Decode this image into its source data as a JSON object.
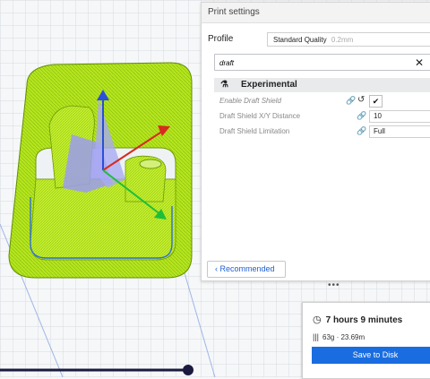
{
  "panel": {
    "title": "Print settings",
    "profile_label": "Profile",
    "profile_value": "Standard Quality",
    "profile_layer": "0.2mm",
    "search_value": "draft",
    "category": "Experimental",
    "settings": [
      {
        "label": "Enable Draft Shield",
        "type": "checkbox",
        "checked": true
      },
      {
        "label": "Draft Shield X/Y Distance",
        "type": "number",
        "value": "10"
      },
      {
        "label": "Draft Shield Limitation",
        "type": "select",
        "value": "Full"
      }
    ],
    "recommended_label": "Recommended"
  },
  "estimate": {
    "time": "7 hours 9 minutes",
    "material": "63g · 23.69m",
    "save_label": "Save to Disk"
  },
  "colors": {
    "accent": "#1a6de0",
    "model": "#b5e61d",
    "axis_x": "#d62b1e",
    "axis_y": "#2a4fd8",
    "axis_z": "#1dbf3a"
  },
  "icons": [
    "clock-icon",
    "spool-icon",
    "flask-icon",
    "link-icon",
    "reset-icon",
    "check-icon",
    "close-icon",
    "chevron-left-icon",
    "chevron-down-icon"
  ]
}
